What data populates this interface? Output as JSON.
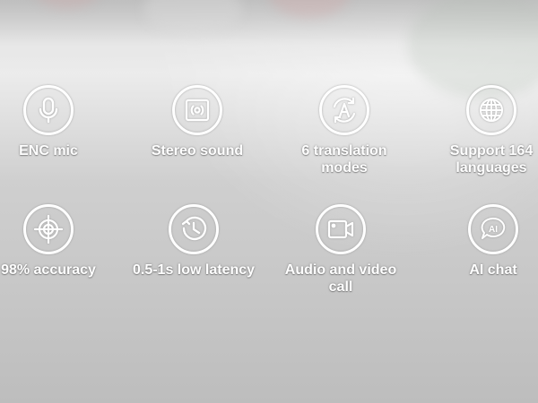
{
  "features": [
    {
      "label": "ENC mic",
      "icon": "microphone-icon"
    },
    {
      "label": "Stereo sound",
      "icon": "speaker-icon"
    },
    {
      "label": "6 translation\nmodes",
      "icon": "translation-cycle-icon"
    },
    {
      "label": "Support 164\nlanguages",
      "icon": "globe-icon"
    },
    {
      "label": "98% accuracy",
      "icon": "crosshair-target-icon"
    },
    {
      "label": "0.5-1s low latency",
      "icon": "clock-icon"
    },
    {
      "label": "Audio and video call",
      "icon": "video-camera-icon"
    },
    {
      "label": "AI chat",
      "icon": "ai-chat-bubble-icon"
    }
  ]
}
